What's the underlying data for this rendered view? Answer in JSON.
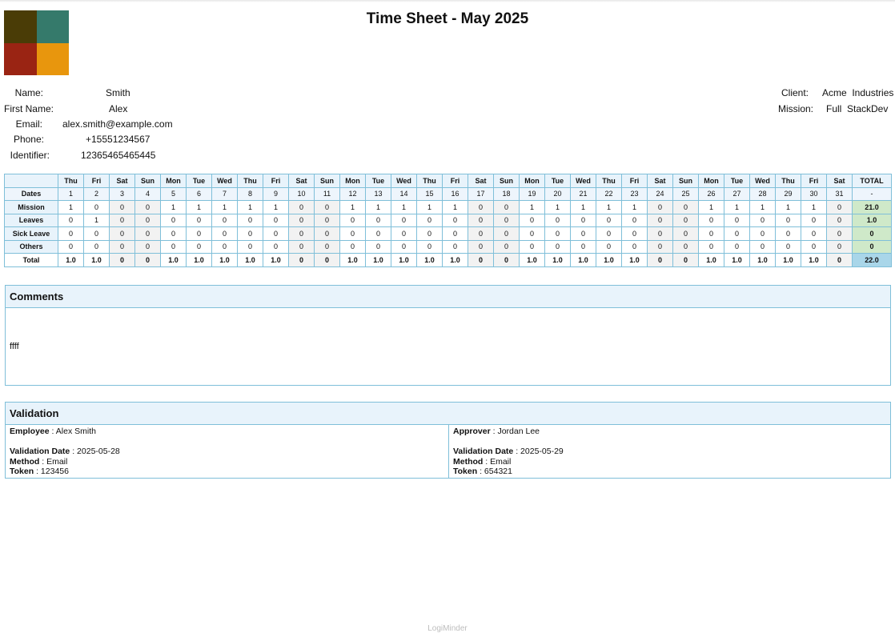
{
  "title": "Time Sheet - May 2025",
  "logo_colors": [
    "#4a3c06",
    "#357a6b",
    "#9a2413",
    "#e8960d"
  ],
  "employee": {
    "name_label": "Name:",
    "name": "Smith",
    "first_name_label": "First Name:",
    "first_name": "Alex",
    "email_label": "Email:",
    "email": "alex.smith@example.com",
    "phone_label": "Phone:",
    "phone": "+15551234567",
    "identifier_label": "Identifier:",
    "identifier": "12365465465445"
  },
  "client": {
    "client_label": "Client:",
    "client": "Acme  Industries",
    "mission_label": "Mission:",
    "mission": "Full  StackDev"
  },
  "timesheet": {
    "days": [
      "Thu",
      "Fri",
      "Sat",
      "Sun",
      "Mon",
      "Tue",
      "Wed",
      "Thu",
      "Fri",
      "Sat",
      "Sun",
      "Mon",
      "Tue",
      "Wed",
      "Thu",
      "Fri",
      "Sat",
      "Sun",
      "Mon",
      "Tue",
      "Wed",
      "Thu",
      "Fri",
      "Sat",
      "Sun",
      "Mon",
      "Tue",
      "Wed",
      "Thu",
      "Fri",
      "Sat"
    ],
    "total_header": "TOTAL",
    "dates_label": "Dates",
    "dates": [
      "1",
      "2",
      "3",
      "4",
      "5",
      "6",
      "7",
      "8",
      "9",
      "10",
      "11",
      "12",
      "13",
      "14",
      "15",
      "16",
      "17",
      "18",
      "19",
      "20",
      "21",
      "22",
      "23",
      "24",
      "25",
      "26",
      "27",
      "28",
      "29",
      "30",
      "31"
    ],
    "dates_total": "-",
    "rows": [
      {
        "label": "Mission",
        "values": [
          "1",
          "0",
          "0",
          "0",
          "1",
          "1",
          "1",
          "1",
          "1",
          "0",
          "0",
          "1",
          "1",
          "1",
          "1",
          "1",
          "0",
          "0",
          "1",
          "1",
          "1",
          "1",
          "1",
          "0",
          "0",
          "1",
          "1",
          "1",
          "1",
          "1",
          "0"
        ],
        "total": "21.0"
      },
      {
        "label": "Leaves",
        "values": [
          "0",
          "1",
          "0",
          "0",
          "0",
          "0",
          "0",
          "0",
          "0",
          "0",
          "0",
          "0",
          "0",
          "0",
          "0",
          "0",
          "0",
          "0",
          "0",
          "0",
          "0",
          "0",
          "0",
          "0",
          "0",
          "0",
          "0",
          "0",
          "0",
          "0",
          "0"
        ],
        "total": "1.0"
      },
      {
        "label": "Sick Leave",
        "values": [
          "0",
          "0",
          "0",
          "0",
          "0",
          "0",
          "0",
          "0",
          "0",
          "0",
          "0",
          "0",
          "0",
          "0",
          "0",
          "0",
          "0",
          "0",
          "0",
          "0",
          "0",
          "0",
          "0",
          "0",
          "0",
          "0",
          "0",
          "0",
          "0",
          "0",
          "0"
        ],
        "total": "0"
      },
      {
        "label": "Others",
        "values": [
          "0",
          "0",
          "0",
          "0",
          "0",
          "0",
          "0",
          "0",
          "0",
          "0",
          "0",
          "0",
          "0",
          "0",
          "0",
          "0",
          "0",
          "0",
          "0",
          "0",
          "0",
          "0",
          "0",
          "0",
          "0",
          "0",
          "0",
          "0",
          "0",
          "0",
          "0"
        ],
        "total": "0"
      }
    ],
    "total_row": {
      "label": "Total",
      "values": [
        "1.0",
        "1.0",
        "0",
        "0",
        "1.0",
        "1.0",
        "1.0",
        "1.0",
        "1.0",
        "0",
        "0",
        "1.0",
        "1.0",
        "1.0",
        "1.0",
        "1.0",
        "0",
        "0",
        "1.0",
        "1.0",
        "1.0",
        "1.0",
        "1.0",
        "0",
        "0",
        "1.0",
        "1.0",
        "1.0",
        "1.0",
        "1.0",
        "0"
      ],
      "total": "22.0"
    }
  },
  "comments": {
    "heading": "Comments",
    "text": "ffff"
  },
  "validation": {
    "heading": "Validation",
    "employee": {
      "role_label": "Employee",
      "person": "Alex Smith",
      "date": "2025-05-28",
      "method": "Email",
      "token": "123456"
    },
    "approver": {
      "role_label": "Approver",
      "person": "Jordan Lee",
      "date": "2025-05-29",
      "method": "Email",
      "token": "654321"
    },
    "date_label": "Validation Date",
    "method_label": "Method",
    "token_label": "Token"
  },
  "footer": "LogiMinder"
}
